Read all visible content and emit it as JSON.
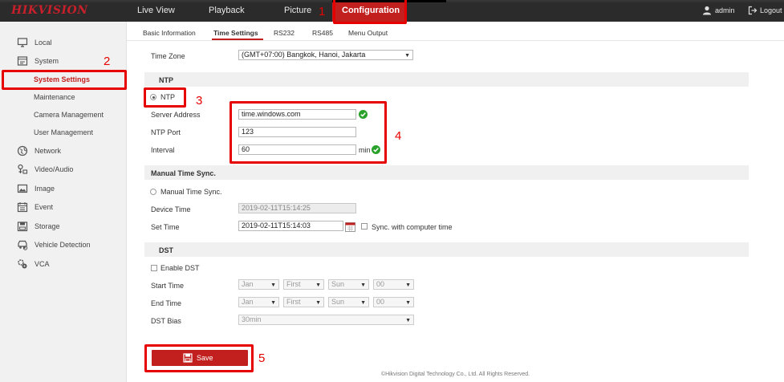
{
  "brand": "HIKVISION",
  "nav": [
    {
      "label": "Live View"
    },
    {
      "label": "Playback"
    },
    {
      "label": "Picture"
    },
    {
      "label": "Configuration"
    }
  ],
  "user": {
    "name": "admin",
    "logout": "Logout"
  },
  "sidebar": {
    "local": "Local",
    "system": "System",
    "system_sub": [
      "System Settings",
      "Maintenance",
      "Camera Management",
      "User Management"
    ],
    "network": "Network",
    "video_audio": "Video/Audio",
    "image": "Image",
    "event": "Event",
    "storage": "Storage",
    "vehicle_detection": "Vehicle Detection",
    "vca": "VCA"
  },
  "tabs": [
    "Basic Information",
    "Time Settings",
    "RS232",
    "RS485",
    "Menu Output"
  ],
  "time_zone": {
    "label": "Time Zone",
    "value": "(GMT+07:00) Bangkok, Hanoi, Jakarta"
  },
  "ntp": {
    "section": "NTP",
    "radio_label": "NTP",
    "server_address_label": "Server Address",
    "server_address": "time.windows.com",
    "port_label": "NTP Port",
    "port": "123",
    "interval_label": "Interval",
    "interval": "60",
    "interval_unit": "min"
  },
  "manual": {
    "section": "Manual Time Sync.",
    "radio_label": "Manual Time Sync.",
    "device_time_label": "Device Time",
    "device_time": "2019-02-11T15:14:25",
    "set_time_label": "Set Time",
    "set_time": "2019-02-11T15:14:03",
    "sync_label": "Sync. with computer time"
  },
  "dst": {
    "section": "DST",
    "enable_label": "Enable DST",
    "start_label": "Start Time",
    "end_label": "End Time",
    "bias_label": "DST Bias",
    "start": {
      "month": "Jan",
      "week": "First",
      "day": "Sun",
      "hour": "00"
    },
    "end": {
      "month": "Jan",
      "week": "First",
      "day": "Sun",
      "hour": "00"
    },
    "bias": "30min"
  },
  "save_label": "Save",
  "footer": "©Hikvision Digital Technology Co., Ltd. All Rights Reserved.",
  "annotations": [
    "1",
    "2",
    "3",
    "4",
    "5"
  ],
  "colors": {
    "accent": "#c21f1f",
    "annotation": "#e60000",
    "topbar": "#2b2b2b",
    "ok": "#2aa12a"
  }
}
